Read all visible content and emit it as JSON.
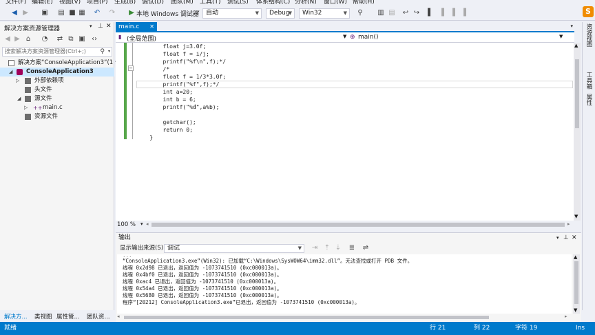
{
  "menu": [
    "文件(F)",
    "编辑(E)",
    "视图(V)",
    "项目(P)",
    "生成(B)",
    "调试(D)",
    "团队(M)",
    "工具(T)",
    "测试(S)",
    "体系结构(C)",
    "分析(N)",
    "窗口(W)",
    "帮助(H)"
  ],
  "toolbar": {
    "debug_target": "本地 Windows 调试器",
    "run_mode": "自动",
    "configuration": "Debug",
    "platform": "Win32"
  },
  "solution_explorer": {
    "title": "解决方案资源管理器",
    "search_placeholder": "搜索解决方案资源管理器(Ctrl+;)",
    "items": [
      {
        "label": "解决方案“ConsoleApplication3”(1 个"
      },
      {
        "label": "ConsoleApplication3"
      },
      {
        "label": "外部依赖项"
      },
      {
        "label": "头文件"
      },
      {
        "label": "源文件"
      },
      {
        "label": "main.c"
      },
      {
        "label": "资源文件"
      }
    ]
  },
  "bottom_tabs": [
    "解决方...",
    "类视图",
    "属性管...",
    "团队资..."
  ],
  "editor": {
    "tab": "main.c",
    "scope": "(全局范围)",
    "function": "main()",
    "lines": [
      "        float j=3.0f;",
      "        float f = i/j;",
      "        printf(\"%f\\n\",f);*/",
      "        /*",
      "        float f = 1/3*3.0f;",
      "        printf(\"%f\",f);*/",
      "        int a=20;",
      "        int b = 6;",
      "        printf(\"%d\",a%b);",
      "",
      "        getchar();",
      "        return 0;",
      "    }"
    ],
    "zoom": "100 %"
  },
  "right_rail": [
    "资源视图",
    "工具箱",
    "属性"
  ],
  "output": {
    "title": "输出",
    "source_label": "显示输出来源(S):",
    "source_value": "调试",
    "lines": [
      "“ConsoleApplication3.exe”(Win32): 已加载“C:\\Windows\\SysWOW64\\imm32.dll”。无法查找或打开 PDB 文件。",
      "线程 0x2d98 已退出，返回值为 -1073741510 (0xc000013a)。",
      "线程 0x4bf0 已退出，返回值为 -1073741510 (0xc000013a)。",
      "线程 0xac4 已退出，返回值为 -1073741510 (0xc000013a)。",
      "线程 0x54a4 已退出，返回值为 -1073741510 (0xc000013a)。",
      "线程 0x5680 已退出，返回值为 -1073741510 (0xc000013a)。",
      "程序“[20212] ConsoleApplication3.exe”已退出，返回值为 -1073741510 (0xc000013a)。"
    ]
  },
  "status": {
    "state": "就绪",
    "row": "行 21",
    "col": "列 22",
    "char": "字符 19",
    "ins": "Ins"
  },
  "colors": {
    "accent": "#007acc",
    "keyword": "#0000ff",
    "comment": "#57a64a",
    "string": "#a31515"
  }
}
